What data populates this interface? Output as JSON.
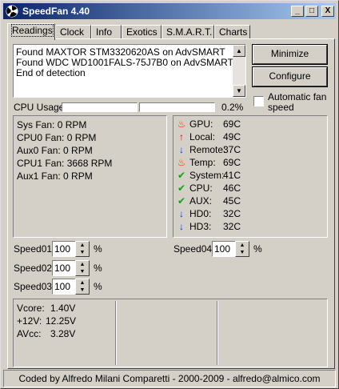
{
  "window": {
    "title": "SpeedFan 4.40",
    "minimize_glyph": "_",
    "maximize_glyph": "□",
    "close_glyph": "X"
  },
  "tabs": [
    {
      "label": "Readings"
    },
    {
      "label": "Clock"
    },
    {
      "label": "Info"
    },
    {
      "label": "Exotics"
    },
    {
      "label": "S.M.A.R.T."
    },
    {
      "label": "Charts"
    }
  ],
  "log": {
    "lines": [
      "Found MAXTOR STM3320620AS on AdvSMART",
      "Found WDC WD1001FALS-75J7B0 on AdvSMART",
      "End of detection"
    ]
  },
  "buttons": {
    "minimize": "Minimize",
    "configure": "Configure"
  },
  "auto_fan": {
    "label_line1": "Automatic fan",
    "label_line2": "speed",
    "checked": false
  },
  "cpu_usage": {
    "label": "CPU Usage",
    "value": "0.2%",
    "bar1_fraction": 0,
    "bar2_fraction": 0
  },
  "fans": [
    {
      "name": "Sys Fan:",
      "value": "0 RPM"
    },
    {
      "name": "CPU0 Fan:",
      "value": "0 RPM"
    },
    {
      "name": "Aux0 Fan:",
      "value": "0 RPM"
    },
    {
      "name": "CPU1 Fan:",
      "value": "3668 RPM"
    },
    {
      "name": "Aux1 Fan:",
      "value": "0 RPM"
    }
  ],
  "temps": [
    {
      "name": "GPU:",
      "value": "69C",
      "icon": "flame-icon"
    },
    {
      "name": "Local:",
      "value": "49C",
      "icon": "arrow-up-icon"
    },
    {
      "name": "Remote:",
      "value": "37C",
      "icon": "arrow-down-icon"
    },
    {
      "name": "Temp:",
      "value": "69C",
      "icon": "flame-icon"
    },
    {
      "name": "System:",
      "value": "41C",
      "icon": "check-icon"
    },
    {
      "name": "CPU:",
      "value": "46C",
      "icon": "check-icon"
    },
    {
      "name": "AUX:",
      "value": "45C",
      "icon": "check-icon"
    },
    {
      "name": "HD0:",
      "value": "32C",
      "icon": "arrow-down-icon"
    },
    {
      "name": "HD3:",
      "value": "32C",
      "icon": "arrow-down-icon"
    }
  ],
  "speeds": [
    {
      "label": "Speed01:",
      "value": "100",
      "unit": "%"
    },
    {
      "label": "Speed02:",
      "value": "100",
      "unit": "%"
    },
    {
      "label": "Speed03:",
      "value": "100",
      "unit": "%"
    },
    {
      "label": "Speed04:",
      "value": "100",
      "unit": "%"
    }
  ],
  "voltages": [
    {
      "name": "Vcore:",
      "value": "1.40V"
    },
    {
      "name": "+12V:",
      "value": "12.25V"
    },
    {
      "name": "AVcc:",
      "value": "3.28V"
    }
  ],
  "status": {
    "text": "Coded by Alfredo Milani Comparetti - 2000-2009 - alfredo@almico.com"
  },
  "colors": {
    "title_start": "#0a246a",
    "title_end": "#a6caf0",
    "flame": "#e04000",
    "arrow_up": "#e00000",
    "arrow_down": "#0030d0",
    "check": "#10a010"
  }
}
